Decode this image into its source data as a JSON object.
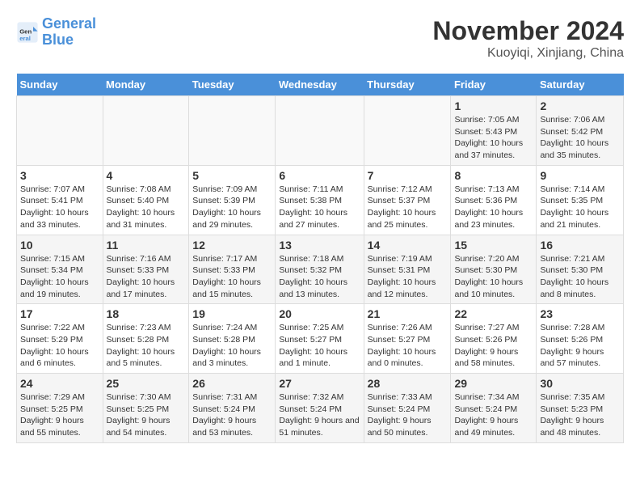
{
  "header": {
    "logo_line1": "General",
    "logo_line2": "Blue",
    "month": "November 2024",
    "location": "Kuoyiqi, Xinjiang, China"
  },
  "weekdays": [
    "Sunday",
    "Monday",
    "Tuesday",
    "Wednesday",
    "Thursday",
    "Friday",
    "Saturday"
  ],
  "weeks": [
    [
      {
        "day": "",
        "info": ""
      },
      {
        "day": "",
        "info": ""
      },
      {
        "day": "",
        "info": ""
      },
      {
        "day": "",
        "info": ""
      },
      {
        "day": "",
        "info": ""
      },
      {
        "day": "1",
        "info": "Sunrise: 7:05 AM\nSunset: 5:43 PM\nDaylight: 10 hours and 37 minutes."
      },
      {
        "day": "2",
        "info": "Sunrise: 7:06 AM\nSunset: 5:42 PM\nDaylight: 10 hours and 35 minutes."
      }
    ],
    [
      {
        "day": "3",
        "info": "Sunrise: 7:07 AM\nSunset: 5:41 PM\nDaylight: 10 hours and 33 minutes."
      },
      {
        "day": "4",
        "info": "Sunrise: 7:08 AM\nSunset: 5:40 PM\nDaylight: 10 hours and 31 minutes."
      },
      {
        "day": "5",
        "info": "Sunrise: 7:09 AM\nSunset: 5:39 PM\nDaylight: 10 hours and 29 minutes."
      },
      {
        "day": "6",
        "info": "Sunrise: 7:11 AM\nSunset: 5:38 PM\nDaylight: 10 hours and 27 minutes."
      },
      {
        "day": "7",
        "info": "Sunrise: 7:12 AM\nSunset: 5:37 PM\nDaylight: 10 hours and 25 minutes."
      },
      {
        "day": "8",
        "info": "Sunrise: 7:13 AM\nSunset: 5:36 PM\nDaylight: 10 hours and 23 minutes."
      },
      {
        "day": "9",
        "info": "Sunrise: 7:14 AM\nSunset: 5:35 PM\nDaylight: 10 hours and 21 minutes."
      }
    ],
    [
      {
        "day": "10",
        "info": "Sunrise: 7:15 AM\nSunset: 5:34 PM\nDaylight: 10 hours and 19 minutes."
      },
      {
        "day": "11",
        "info": "Sunrise: 7:16 AM\nSunset: 5:33 PM\nDaylight: 10 hours and 17 minutes."
      },
      {
        "day": "12",
        "info": "Sunrise: 7:17 AM\nSunset: 5:33 PM\nDaylight: 10 hours and 15 minutes."
      },
      {
        "day": "13",
        "info": "Sunrise: 7:18 AM\nSunset: 5:32 PM\nDaylight: 10 hours and 13 minutes."
      },
      {
        "day": "14",
        "info": "Sunrise: 7:19 AM\nSunset: 5:31 PM\nDaylight: 10 hours and 12 minutes."
      },
      {
        "day": "15",
        "info": "Sunrise: 7:20 AM\nSunset: 5:30 PM\nDaylight: 10 hours and 10 minutes."
      },
      {
        "day": "16",
        "info": "Sunrise: 7:21 AM\nSunset: 5:30 PM\nDaylight: 10 hours and 8 minutes."
      }
    ],
    [
      {
        "day": "17",
        "info": "Sunrise: 7:22 AM\nSunset: 5:29 PM\nDaylight: 10 hours and 6 minutes."
      },
      {
        "day": "18",
        "info": "Sunrise: 7:23 AM\nSunset: 5:28 PM\nDaylight: 10 hours and 5 minutes."
      },
      {
        "day": "19",
        "info": "Sunrise: 7:24 AM\nSunset: 5:28 PM\nDaylight: 10 hours and 3 minutes."
      },
      {
        "day": "20",
        "info": "Sunrise: 7:25 AM\nSunset: 5:27 PM\nDaylight: 10 hours and 1 minute."
      },
      {
        "day": "21",
        "info": "Sunrise: 7:26 AM\nSunset: 5:27 PM\nDaylight: 10 hours and 0 minutes."
      },
      {
        "day": "22",
        "info": "Sunrise: 7:27 AM\nSunset: 5:26 PM\nDaylight: 9 hours and 58 minutes."
      },
      {
        "day": "23",
        "info": "Sunrise: 7:28 AM\nSunset: 5:26 PM\nDaylight: 9 hours and 57 minutes."
      }
    ],
    [
      {
        "day": "24",
        "info": "Sunrise: 7:29 AM\nSunset: 5:25 PM\nDaylight: 9 hours and 55 minutes."
      },
      {
        "day": "25",
        "info": "Sunrise: 7:30 AM\nSunset: 5:25 PM\nDaylight: 9 hours and 54 minutes."
      },
      {
        "day": "26",
        "info": "Sunrise: 7:31 AM\nSunset: 5:24 PM\nDaylight: 9 hours and 53 minutes."
      },
      {
        "day": "27",
        "info": "Sunrise: 7:32 AM\nSunset: 5:24 PM\nDaylight: 9 hours and 51 minutes."
      },
      {
        "day": "28",
        "info": "Sunrise: 7:33 AM\nSunset: 5:24 PM\nDaylight: 9 hours and 50 minutes."
      },
      {
        "day": "29",
        "info": "Sunrise: 7:34 AM\nSunset: 5:24 PM\nDaylight: 9 hours and 49 minutes."
      },
      {
        "day": "30",
        "info": "Sunrise: 7:35 AM\nSunset: 5:23 PM\nDaylight: 9 hours and 48 minutes."
      }
    ]
  ]
}
